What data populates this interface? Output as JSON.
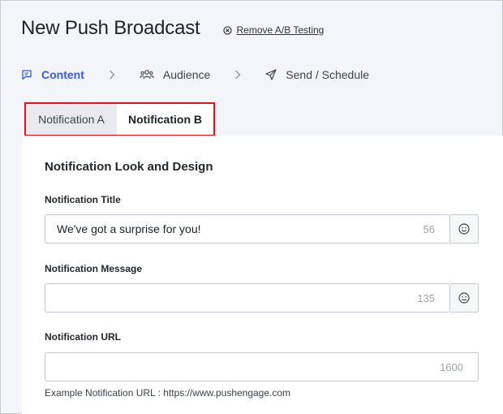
{
  "header": {
    "title": "New Push Broadcast",
    "remove_ab_label": "Remove A/B Testing"
  },
  "steps": [
    {
      "label": "Content",
      "icon": "message-square-icon",
      "active": true
    },
    {
      "label": "Audience",
      "icon": "users-icon",
      "active": false
    },
    {
      "label": "Send / Schedule",
      "icon": "send-icon",
      "active": false
    }
  ],
  "tabs": [
    {
      "label": "Notification A",
      "selected": false
    },
    {
      "label": "Notification B",
      "selected": true
    }
  ],
  "form": {
    "section_title": "Notification Look and Design",
    "title_field": {
      "label": "Notification Title",
      "value": "We've got a surprise for you!",
      "count": "56"
    },
    "message_field": {
      "label": "Notification Message",
      "value": "",
      "count": "135"
    },
    "url_field": {
      "label": "Notification URL",
      "value": "",
      "count": "1600",
      "help": "Example Notification URL : https://www.pushengage.com"
    }
  },
  "colors": {
    "accent": "#3858e9",
    "highlight_border": "#e0141e",
    "background": "#f4f5fa"
  }
}
